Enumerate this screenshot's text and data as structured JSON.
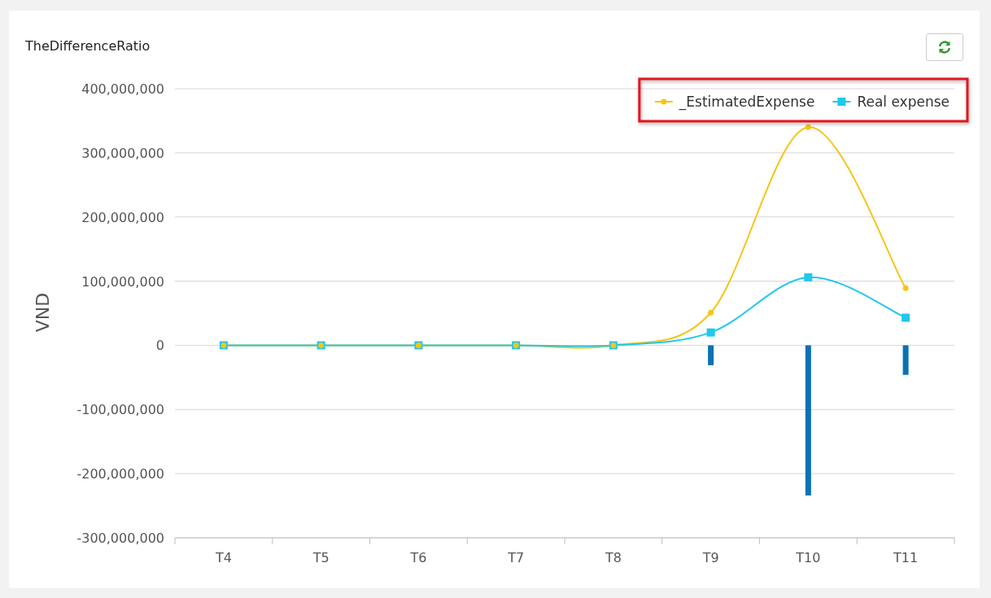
{
  "card": {
    "title": "TheDifferenceRatio",
    "chart_data": {
      "type": "line",
      "ylabel": "VND",
      "categories": [
        "T4",
        "T5",
        "T6",
        "T7",
        "T8",
        "T9",
        "T10",
        "T11"
      ],
      "ylim": [
        -300000000,
        400000000
      ],
      "grid": true,
      "legend": true,
      "yticks": [
        {
          "value": -300000000,
          "label": "-300,000,000"
        },
        {
          "value": -200000000,
          "label": "-200,000,000"
        },
        {
          "value": -100000000,
          "label": "-100,000,000"
        },
        {
          "value": 0,
          "label": "0"
        },
        {
          "value": 100000000,
          "label": "100,000,000"
        },
        {
          "value": 200000000,
          "label": "200,000,000"
        },
        {
          "value": 300000000,
          "label": "300,000,000"
        },
        {
          "value": 400000000,
          "label": "400,000,000"
        }
      ],
      "series": [
        {
          "name": "_EstimatedExpense",
          "marker": "circle",
          "color": "#f5c518",
          "values": [
            0,
            0,
            0,
            0,
            0,
            51000000,
            340000000,
            89000000
          ]
        },
        {
          "name": "Real expense",
          "marker": "square",
          "color": "#1ec8ee",
          "values": [
            0,
            0,
            0,
            0,
            0,
            20000000,
            106000000,
            43000000
          ]
        },
        {
          "type": "bar",
          "color": "#0a72b5",
          "values": [
            null,
            null,
            null,
            null,
            null,
            -31000000,
            -234000000,
            -46000000
          ]
        }
      ]
    },
    "legend_highlighted": true
  }
}
